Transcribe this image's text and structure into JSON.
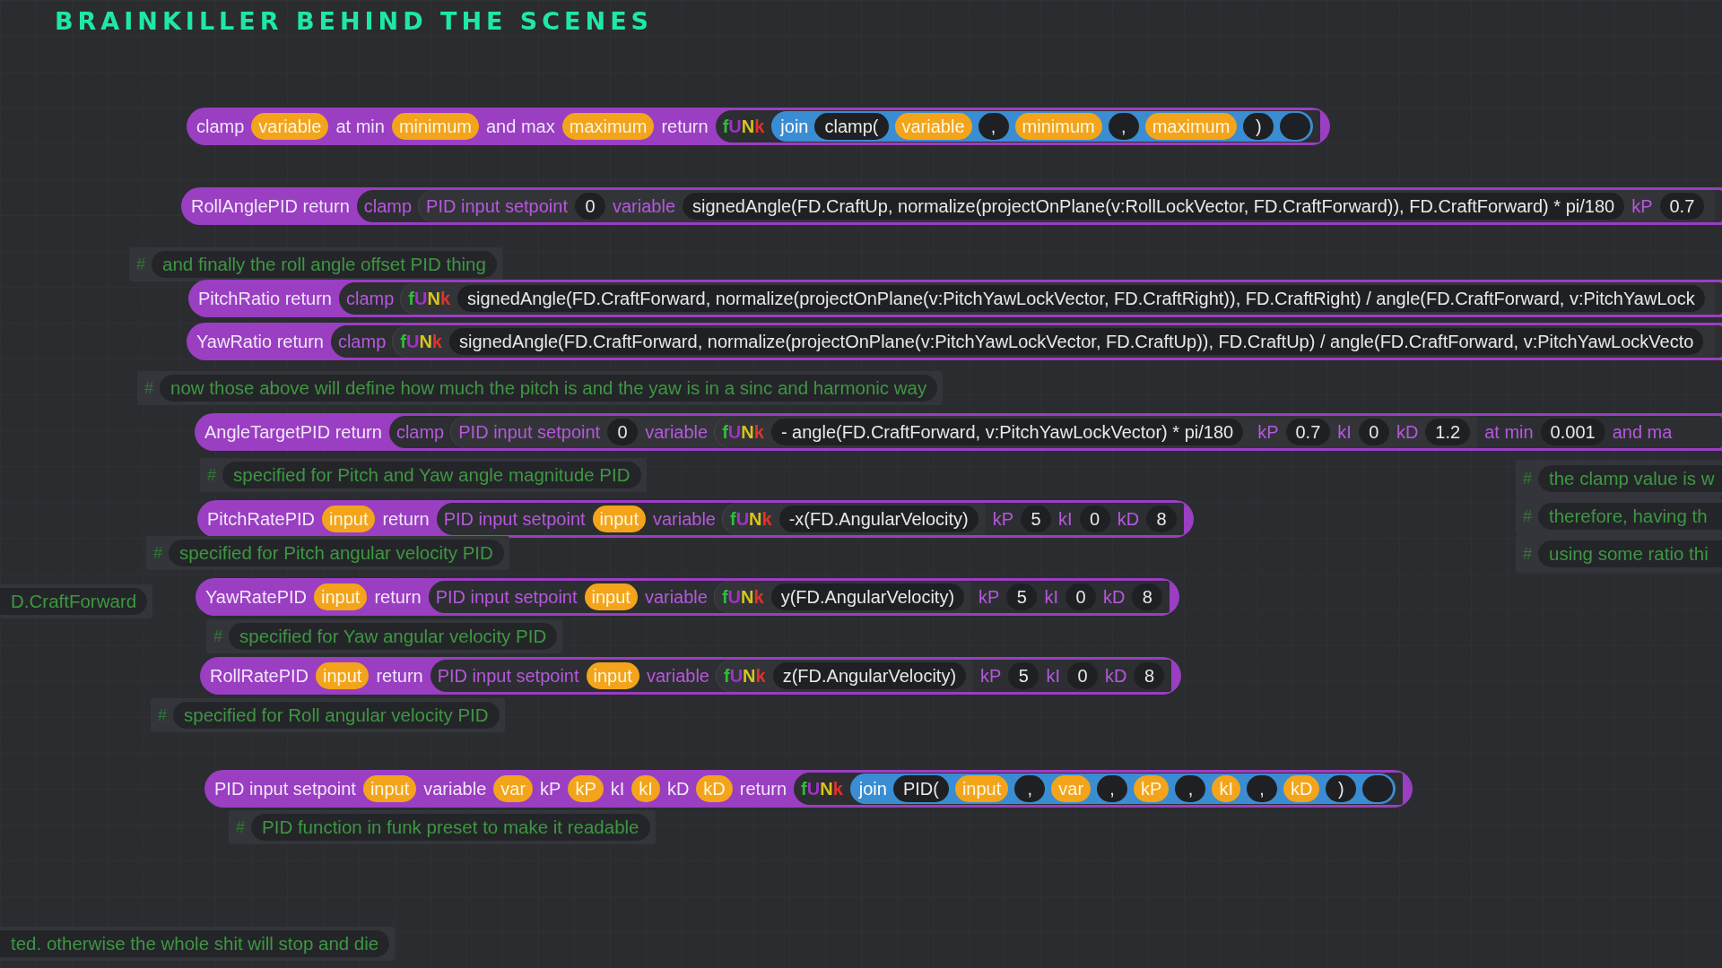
{
  "title": "BRAINKILLER BEHIND THE SCENES",
  "canvas": {
    "items": [
      {
        "kind": "block",
        "parts": [
          {
            "kind": "label",
            "text": "clamp"
          },
          {
            "kind": "var",
            "text": "variable"
          },
          {
            "kind": "label",
            "text": "at min"
          },
          {
            "kind": "var",
            "text": "minimum"
          },
          {
            "kind": "label",
            "text": "and max"
          },
          {
            "kind": "var",
            "text": "maximum"
          },
          {
            "kind": "label",
            "text": "return"
          },
          {
            "kind": "reporter",
            "parts": [
              {
                "kind": "funk",
                "text": "fUNk"
              },
              {
                "kind": "join",
                "parts": [
                  {
                    "kind": "label",
                    "text": "join"
                  },
                  {
                    "kind": "field",
                    "text": "clamp("
                  },
                  {
                    "kind": "var",
                    "text": "variable"
                  },
                  {
                    "kind": "field",
                    "text": ","
                  },
                  {
                    "kind": "var",
                    "text": "minimum"
                  },
                  {
                    "kind": "field",
                    "text": ","
                  },
                  {
                    "kind": "var",
                    "text": "maximum"
                  },
                  {
                    "kind": "field",
                    "text": ")"
                  },
                  {
                    "kind": "empty"
                  }
                ]
              }
            ]
          }
        ]
      },
      {
        "kind": "block",
        "parts": [
          {
            "kind": "label",
            "text": "RollAnglePID return"
          },
          {
            "kind": "reporter",
            "parts": [
              {
                "kind": "label",
                "text": "clamp"
              },
              {
                "kind": "reporter",
                "parts": [
                  {
                    "kind": "label",
                    "text": "PID input setpoint"
                  },
                  {
                    "kind": "field",
                    "text": "0"
                  },
                  {
                    "kind": "label",
                    "text": "variable"
                  },
                  {
                    "kind": "field",
                    "text": "signedAngle(FD.CraftUp, normalize(projectOnPlane(v:RollLockVector, FD.CraftForward)), FD.CraftForward) * pi/180"
                  },
                  {
                    "kind": "label",
                    "text": "kP"
                  },
                  {
                    "kind": "field",
                    "text": "0.7"
                  }
                ]
              }
            ]
          }
        ]
      },
      {
        "kind": "comment",
        "marker": "#",
        "text": "and finally the roll angle offset PID thing"
      },
      {
        "kind": "block",
        "parts": [
          {
            "kind": "label",
            "text": "PitchRatio return"
          },
          {
            "kind": "reporter",
            "parts": [
              {
                "kind": "label",
                "text": "clamp"
              },
              {
                "kind": "reporter",
                "parts": [
                  {
                    "kind": "funk",
                    "text": "fUNk"
                  },
                  {
                    "kind": "field",
                    "text": "signedAngle(FD.CraftForward, normalize(projectOnPlane(v:PitchYawLockVector, FD.CraftRight)), FD.CraftRight) / angle(FD.CraftForward, v:PitchYawLock"
                  }
                ]
              }
            ]
          }
        ]
      },
      {
        "kind": "block",
        "parts": [
          {
            "kind": "label",
            "text": "YawRatio return"
          },
          {
            "kind": "reporter",
            "parts": [
              {
                "kind": "label",
                "text": "clamp"
              },
              {
                "kind": "reporter",
                "parts": [
                  {
                    "kind": "funk",
                    "text": "fUNk"
                  },
                  {
                    "kind": "field",
                    "text": "signedAngle(FD.CraftForward, normalize(projectOnPlane(v:PitchYawLockVector, FD.CraftUp)), FD.CraftUp) / angle(FD.CraftForward, v:PitchYawLockVecto"
                  }
                ]
              }
            ]
          }
        ]
      },
      {
        "kind": "comment",
        "marker": "#",
        "text": "now those above will define how much the pitch is and the yaw is in a sinc and harmonic way"
      },
      {
        "kind": "block",
        "parts": [
          {
            "kind": "label",
            "text": "AngleTargetPID return"
          },
          {
            "kind": "reporter",
            "parts": [
              {
                "kind": "label",
                "text": "clamp"
              },
              {
                "kind": "reporter",
                "parts": [
                  {
                    "kind": "label",
                    "text": "PID input setpoint"
                  },
                  {
                    "kind": "field",
                    "text": "0"
                  },
                  {
                    "kind": "label",
                    "text": "variable"
                  },
                  {
                    "kind": "reporter",
                    "parts": [
                      {
                        "kind": "funk",
                        "text": "fUNk"
                      },
                      {
                        "kind": "field",
                        "text": "- angle(FD.CraftForward, v:PitchYawLockVector) * pi/180"
                      }
                    ]
                  },
                  {
                    "kind": "label",
                    "text": "kP"
                  },
                  {
                    "kind": "field",
                    "text": "0.7"
                  },
                  {
                    "kind": "label",
                    "text": "kI"
                  },
                  {
                    "kind": "field",
                    "text": "0"
                  },
                  {
                    "kind": "label",
                    "text": "kD"
                  },
                  {
                    "kind": "field",
                    "text": "1.2"
                  }
                ]
              },
              {
                "kind": "label",
                "text": "at min"
              },
              {
                "kind": "field",
                "text": "0.001"
              },
              {
                "kind": "label",
                "text": "and ma"
              }
            ]
          }
        ]
      },
      {
        "kind": "comment",
        "marker": "#",
        "text": "specified for Pitch and Yaw angle magnitude PID"
      },
      {
        "kind": "comment",
        "marker": "#",
        "text": "the clamp value is w"
      },
      {
        "kind": "block",
        "parts": [
          {
            "kind": "label",
            "text": "PitchRatePID"
          },
          {
            "kind": "var",
            "text": "input"
          },
          {
            "kind": "label",
            "text": "return"
          },
          {
            "kind": "reporter",
            "parts": [
              {
                "kind": "label",
                "text": "PID input setpoint"
              },
              {
                "kind": "var",
                "text": "input"
              },
              {
                "kind": "label",
                "text": "variable"
              },
              {
                "kind": "reporter",
                "parts": [
                  {
                    "kind": "funk",
                    "text": "fUNk"
                  },
                  {
                    "kind": "field",
                    "text": "-x(FD.AngularVelocity)"
                  }
                ]
              },
              {
                "kind": "label",
                "text": "kP"
              },
              {
                "kind": "field",
                "text": "5"
              },
              {
                "kind": "label",
                "text": "kI"
              },
              {
                "kind": "field",
                "text": "0"
              },
              {
                "kind": "label",
                "text": "kD"
              },
              {
                "kind": "field",
                "text": "8"
              }
            ]
          }
        ]
      },
      {
        "kind": "comment",
        "marker": "#",
        "text": "therefore, having th"
      },
      {
        "kind": "comment",
        "marker": "#",
        "text": "specified for Pitch angular velocity PID"
      },
      {
        "kind": "comment",
        "marker": "#",
        "text": "using some ratio thi"
      },
      {
        "kind": "comment",
        "text": "D.CraftForward"
      },
      {
        "kind": "block",
        "parts": [
          {
            "kind": "label",
            "text": "YawRatePID"
          },
          {
            "kind": "var",
            "text": "input"
          },
          {
            "kind": "label",
            "text": "return"
          },
          {
            "kind": "reporter",
            "parts": [
              {
                "kind": "label",
                "text": "PID input setpoint"
              },
              {
                "kind": "var",
                "text": "input"
              },
              {
                "kind": "label",
                "text": "variable"
              },
              {
                "kind": "reporter",
                "parts": [
                  {
                    "kind": "funk",
                    "text": "fUNk"
                  },
                  {
                    "kind": "field",
                    "text": "y(FD.AngularVelocity)"
                  }
                ]
              },
              {
                "kind": "label",
                "text": "kP"
              },
              {
                "kind": "field",
                "text": "5"
              },
              {
                "kind": "label",
                "text": "kI"
              },
              {
                "kind": "field",
                "text": "0"
              },
              {
                "kind": "label",
                "text": "kD"
              },
              {
                "kind": "field",
                "text": "8"
              }
            ]
          }
        ]
      },
      {
        "kind": "comment",
        "marker": "#",
        "text": "specified for Yaw angular velocity PID"
      },
      {
        "kind": "block",
        "parts": [
          {
            "kind": "label",
            "text": "RollRatePID"
          },
          {
            "kind": "var",
            "text": "input"
          },
          {
            "kind": "label",
            "text": "return"
          },
          {
            "kind": "reporter",
            "parts": [
              {
                "kind": "label",
                "text": "PID input setpoint"
              },
              {
                "kind": "var",
                "text": "input"
              },
              {
                "kind": "label",
                "text": "variable"
              },
              {
                "kind": "reporter",
                "parts": [
                  {
                    "kind": "funk",
                    "text": "fUNk"
                  },
                  {
                    "kind": "field",
                    "text": "z(FD.AngularVelocity)"
                  }
                ]
              },
              {
                "kind": "label",
                "text": "kP"
              },
              {
                "kind": "field",
                "text": "5"
              },
              {
                "kind": "label",
                "text": "kI"
              },
              {
                "kind": "field",
                "text": "0"
              },
              {
                "kind": "label",
                "text": "kD"
              },
              {
                "kind": "field",
                "text": "8"
              }
            ]
          }
        ]
      },
      {
        "kind": "comment",
        "marker": "#",
        "text": "specified for Roll angular velocity PID"
      },
      {
        "kind": "block",
        "parts": [
          {
            "kind": "label",
            "text": "PID input setpoint"
          },
          {
            "kind": "var",
            "text": "input"
          },
          {
            "kind": "label",
            "text": "variable"
          },
          {
            "kind": "var",
            "text": "var"
          },
          {
            "kind": "label",
            "text": "kP"
          },
          {
            "kind": "var",
            "text": "kP"
          },
          {
            "kind": "label",
            "text": "kI"
          },
          {
            "kind": "var",
            "text": "kI"
          },
          {
            "kind": "label",
            "text": "kD"
          },
          {
            "kind": "var",
            "text": "kD"
          },
          {
            "kind": "label",
            "text": "return"
          },
          {
            "kind": "reporter",
            "parts": [
              {
                "kind": "funk",
                "text": "fUNk"
              },
              {
                "kind": "join",
                "parts": [
                  {
                    "kind": "label",
                    "text": "join"
                  },
                  {
                    "kind": "field",
                    "text": "PID("
                  },
                  {
                    "kind": "var",
                    "text": "input"
                  },
                  {
                    "kind": "field",
                    "text": ","
                  },
                  {
                    "kind": "var",
                    "text": "var"
                  },
                  {
                    "kind": "field",
                    "text": ","
                  },
                  {
                    "kind": "var",
                    "text": "kP"
                  },
                  {
                    "kind": "field",
                    "text": ","
                  },
                  {
                    "kind": "var",
                    "text": "kI"
                  },
                  {
                    "kind": "field",
                    "text": ","
                  },
                  {
                    "kind": "var",
                    "text": "kD"
                  },
                  {
                    "kind": "field",
                    "text": ")"
                  },
                  {
                    "kind": "empty"
                  }
                ]
              }
            ]
          }
        ]
      },
      {
        "kind": "comment",
        "marker": "#",
        "text": "PID function in funk preset to make it readable"
      },
      {
        "kind": "comment",
        "text": "ted. otherwise the whole shit will stop and die"
      }
    ]
  }
}
